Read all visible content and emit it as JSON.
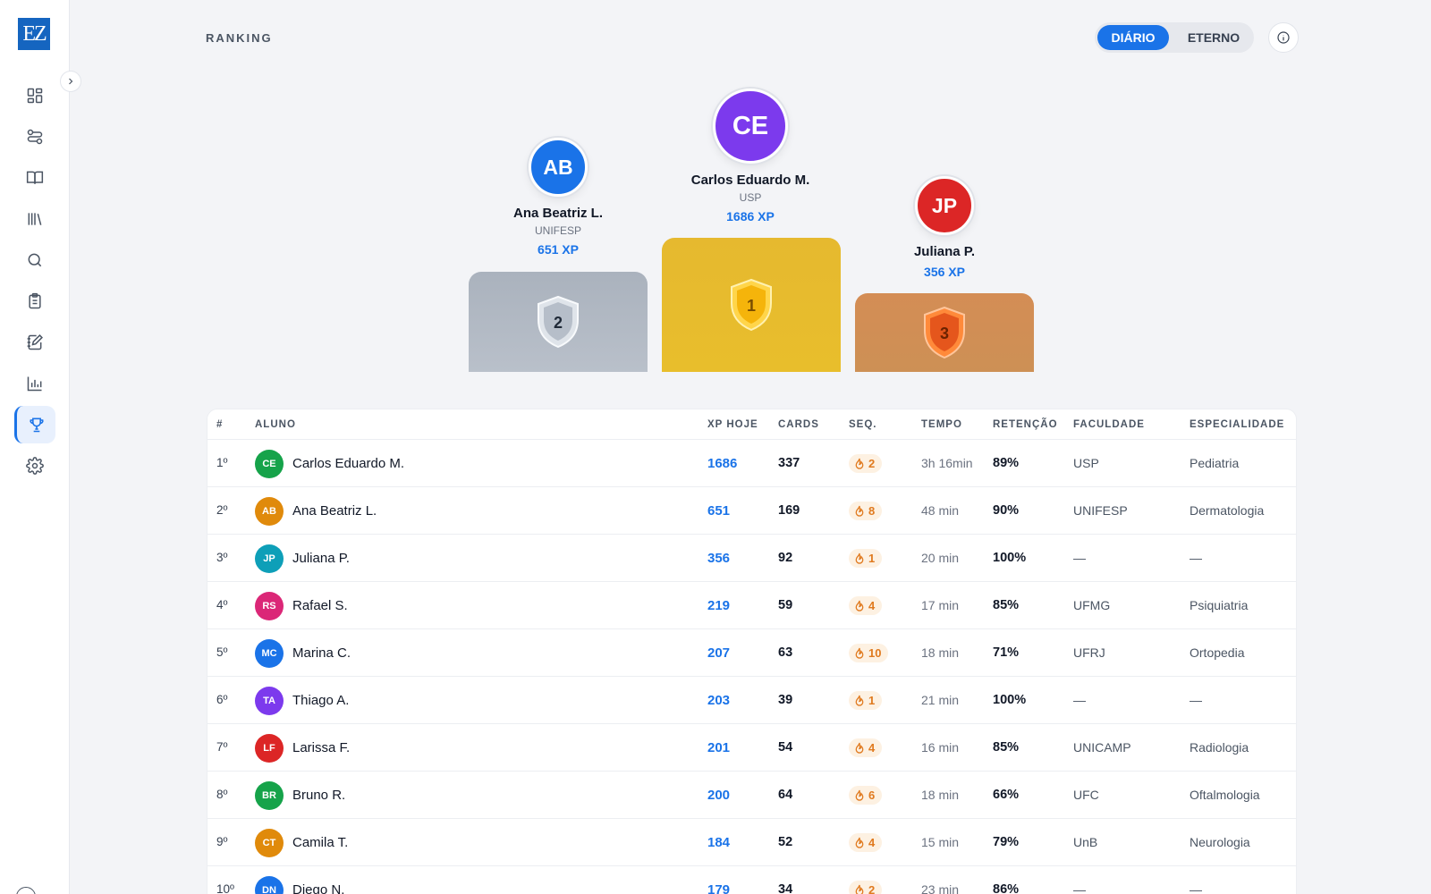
{
  "app": {
    "logo_text": "EZ",
    "brand_color": "#1565c0",
    "accent_color": "#1a73e8"
  },
  "sidebar": {
    "items": [
      {
        "icon": "dashboard-icon",
        "active": false
      },
      {
        "icon": "flow-icon",
        "active": false
      },
      {
        "icon": "book-icon",
        "active": false
      },
      {
        "icon": "library-icon",
        "active": false
      },
      {
        "icon": "search-icon",
        "active": false
      },
      {
        "icon": "clipboard-icon",
        "active": false
      },
      {
        "icon": "notebook-edit-icon",
        "active": false
      },
      {
        "icon": "bar-chart-icon",
        "active": false
      },
      {
        "icon": "trophy-icon",
        "active": true
      },
      {
        "icon": "gear-icon",
        "active": false
      }
    ]
  },
  "header": {
    "title": "RANKING",
    "toggle": {
      "active": "DIÁRIO",
      "inactive": "ETERNO"
    }
  },
  "podium": {
    "first": {
      "initials": "CE",
      "name": "Carlos Eduardo M.",
      "school": "USP",
      "xp": "1686 XP",
      "place": "1",
      "color": "#7c3aed"
    },
    "second": {
      "initials": "AB",
      "name": "Ana Beatriz L.",
      "school": "UNIFESP",
      "xp": "651 XP",
      "place": "2",
      "color": "#1a73e8"
    },
    "third": {
      "initials": "JP",
      "name": "Juliana P.",
      "school": "",
      "xp": "356 XP",
      "place": "3",
      "color": "#dc2626"
    }
  },
  "table": {
    "headers": {
      "rank": "#",
      "student": "ALUNO",
      "xp": "XP HOJE",
      "cards": "CARDS",
      "seq": "SEQ.",
      "time": "TEMPO",
      "retention": "RETENÇÃO",
      "faculty": "FACULDADE",
      "specialty": "ESPECIALIDADE"
    },
    "rows": [
      {
        "rank": "1º",
        "initials": "CE",
        "color": "#16a34a",
        "name": "Carlos Eduardo M.",
        "xp": "1686",
        "cards": "337",
        "seq": "2",
        "time": "3h 16min",
        "retention": "89%",
        "faculty": "USP",
        "specialty": "Pediatria"
      },
      {
        "rank": "2º",
        "initials": "AB",
        "color": "#e08a0b",
        "name": "Ana Beatriz L.",
        "xp": "651",
        "cards": "169",
        "seq": "8",
        "time": "48 min",
        "retention": "90%",
        "faculty": "UNIFESP",
        "specialty": "Dermatologia"
      },
      {
        "rank": "3º",
        "initials": "JP",
        "color": "#0e9fb8",
        "name": "Juliana P.",
        "xp": "356",
        "cards": "92",
        "seq": "1",
        "time": "20 min",
        "retention": "100%",
        "faculty": "—",
        "specialty": "—"
      },
      {
        "rank": "4º",
        "initials": "RS",
        "color": "#db2777",
        "name": "Rafael S.",
        "xp": "219",
        "cards": "59",
        "seq": "4",
        "time": "17 min",
        "retention": "85%",
        "faculty": "UFMG",
        "specialty": "Psiquiatria"
      },
      {
        "rank": "5º",
        "initials": "MC",
        "color": "#1a73e8",
        "name": "Marina C.",
        "xp": "207",
        "cards": "63",
        "seq": "10",
        "time": "18 min",
        "retention": "71%",
        "faculty": "UFRJ",
        "specialty": "Ortopedia"
      },
      {
        "rank": "6º",
        "initials": "TA",
        "color": "#7c3aed",
        "name": "Thiago A.",
        "xp": "203",
        "cards": "39",
        "seq": "1",
        "time": "21 min",
        "retention": "100%",
        "faculty": "—",
        "specialty": "—"
      },
      {
        "rank": "7º",
        "initials": "LF",
        "color": "#dc2626",
        "name": "Larissa F.",
        "xp": "201",
        "cards": "54",
        "seq": "4",
        "time": "16 min",
        "retention": "85%",
        "faculty": "UNICAMP",
        "specialty": "Radiologia"
      },
      {
        "rank": "8º",
        "initials": "BR",
        "color": "#16a34a",
        "name": "Bruno R.",
        "xp": "200",
        "cards": "64",
        "seq": "6",
        "time": "18 min",
        "retention": "66%",
        "faculty": "UFC",
        "specialty": "Oftalmologia"
      },
      {
        "rank": "9º",
        "initials": "CT",
        "color": "#e08a0b",
        "name": "Camila T.",
        "xp": "184",
        "cards": "52",
        "seq": "4",
        "time": "15 min",
        "retention": "79%",
        "faculty": "UnB",
        "specialty": "Neurologia"
      },
      {
        "rank": "10º",
        "initials": "DN",
        "color": "#1a73e8",
        "name": "Diego N.",
        "xp": "179",
        "cards": "34",
        "seq": "2",
        "time": "23 min",
        "retention": "86%",
        "faculty": "—",
        "specialty": "—"
      }
    ]
  }
}
